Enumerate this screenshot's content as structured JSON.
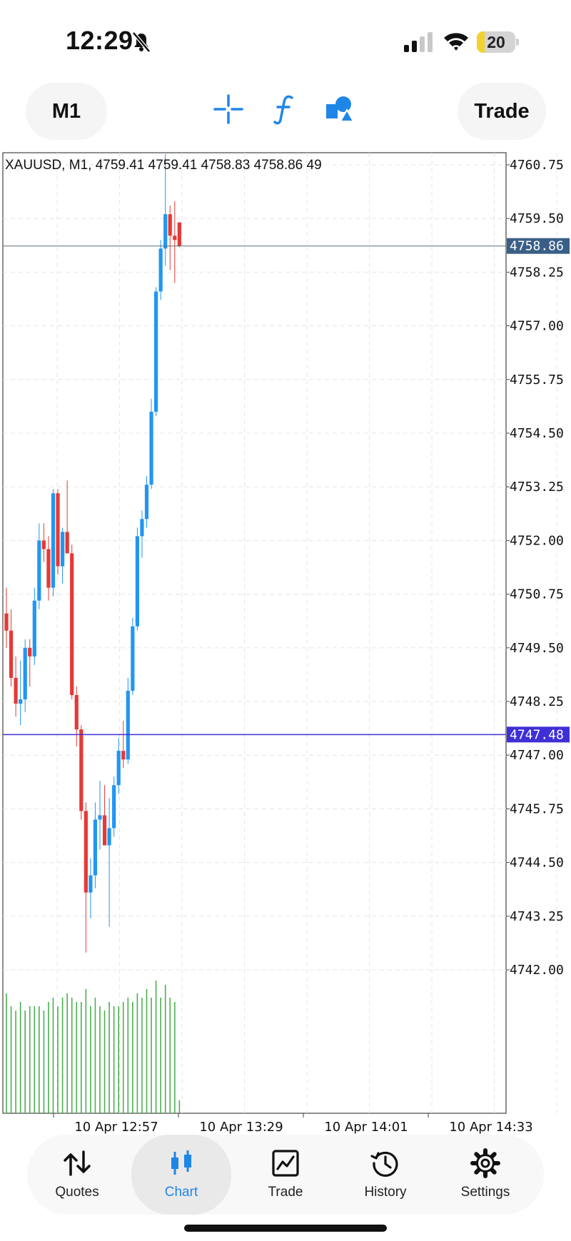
{
  "status_bar": {
    "time": "12:29",
    "battery_level": "20",
    "battery_fraction": 0.2
  },
  "toolbar": {
    "timeframe": "M1",
    "trade_label": "Trade",
    "icons": [
      "crosshair-icon",
      "function-icon",
      "objects-icon"
    ]
  },
  "chart": {
    "info": "XAUUSD, M1, 4759.41 4759.41 4758.83 4758.86 49",
    "current_price_label": "4758.86",
    "line_price_label": "4747.48",
    "price_ticks": [
      "4760.75",
      "4759.50",
      "4758.25",
      "4757.00",
      "4755.75",
      "4754.50",
      "4753.25",
      "4752.00",
      "4750.75",
      "4749.50",
      "4748.25",
      "4747.00",
      "4745.75",
      "4744.50",
      "4743.25",
      "4742.00"
    ],
    "time_ticks": [
      "10 Apr 12:57",
      "10 Apr 13:29",
      "10 Apr 14:01",
      "10 Apr 14:33"
    ],
    "colors": {
      "bull": "#2196f3",
      "bear": "#e53935",
      "volume": "#4caf50",
      "price_line": "#5c6b73",
      "horizontal_line": "#3f2fd6"
    }
  },
  "chart_data": {
    "type": "candlestick",
    "symbol": "XAUUSD",
    "timeframe": "M1",
    "ylim": [
      4741.0,
      4761.0
    ],
    "candles": [
      {
        "o": 4750.3,
        "h": 4750.9,
        "l": 4749.5,
        "c": 4749.9
      },
      {
        "o": 4749.9,
        "h": 4750.4,
        "l": 4748.6,
        "c": 4748.8
      },
      {
        "o": 4748.8,
        "h": 4749.3,
        "l": 4747.9,
        "c": 4748.2
      },
      {
        "o": 4748.2,
        "h": 4749.2,
        "l": 4747.7,
        "c": 4748.3
      },
      {
        "o": 4748.3,
        "h": 4749.7,
        "l": 4748.0,
        "c": 4749.5
      },
      {
        "o": 4749.5,
        "h": 4749.7,
        "l": 4748.6,
        "c": 4749.3
      },
      {
        "o": 4749.3,
        "h": 4750.9,
        "l": 4749.1,
        "c": 4750.6
      },
      {
        "o": 4750.6,
        "h": 4752.4,
        "l": 4750.4,
        "c": 4752.0
      },
      {
        "o": 4752.0,
        "h": 4752.4,
        "l": 4751.5,
        "c": 4751.8
      },
      {
        "o": 4751.8,
        "h": 4752.1,
        "l": 4750.6,
        "c": 4750.9
      },
      {
        "o": 4750.9,
        "h": 4753.2,
        "l": 4750.7,
        "c": 4753.1
      },
      {
        "o": 4753.1,
        "h": 4753.2,
        "l": 4751.2,
        "c": 4751.4
      },
      {
        "o": 4751.4,
        "h": 4752.3,
        "l": 4751.0,
        "c": 4752.2
      },
      {
        "o": 4752.2,
        "h": 4753.4,
        "l": 4751.7,
        "c": 4751.7
      },
      {
        "o": 4751.7,
        "h": 4751.9,
        "l": 4748.3,
        "c": 4748.4
      },
      {
        "o": 4748.4,
        "h": 4748.6,
        "l": 4747.2,
        "c": 4747.6
      },
      {
        "o": 4747.6,
        "h": 4747.7,
        "l": 4745.5,
        "c": 4745.7
      },
      {
        "o": 4745.7,
        "h": 4745.9,
        "l": 4742.4,
        "c": 4743.8
      },
      {
        "o": 4743.8,
        "h": 4744.6,
        "l": 4743.2,
        "c": 4744.2
      },
      {
        "o": 4744.2,
        "h": 4745.9,
        "l": 4743.9,
        "c": 4745.5
      },
      {
        "o": 4745.5,
        "h": 4746.4,
        "l": 4744.8,
        "c": 4745.6
      },
      {
        "o": 4745.6,
        "h": 4746.3,
        "l": 4744.9,
        "c": 4744.9
      },
      {
        "o": 4744.9,
        "h": 4746.0,
        "l": 4743.0,
        "c": 4745.3
      },
      {
        "o": 4745.3,
        "h": 4746.5,
        "l": 4745.1,
        "c": 4746.3
      },
      {
        "o": 4746.3,
        "h": 4747.4,
        "l": 4746.1,
        "c": 4747.1
      },
      {
        "o": 4747.1,
        "h": 4747.8,
        "l": 4746.7,
        "c": 4746.9
      },
      {
        "o": 4746.9,
        "h": 4748.8,
        "l": 4746.8,
        "c": 4748.5
      },
      {
        "o": 4748.5,
        "h": 4750.2,
        "l": 4748.4,
        "c": 4750.0
      },
      {
        "o": 4750.0,
        "h": 4752.3,
        "l": 4749.9,
        "c": 4752.1
      },
      {
        "o": 4752.1,
        "h": 4752.7,
        "l": 4751.6,
        "c": 4752.5
      },
      {
        "o": 4752.5,
        "h": 4753.5,
        "l": 4752.3,
        "c": 4753.3
      },
      {
        "o": 4753.3,
        "h": 4755.3,
        "l": 4753.2,
        "c": 4755.0
      },
      {
        "o": 4755.0,
        "h": 4757.9,
        "l": 4754.9,
        "c": 4757.8
      },
      {
        "o": 4757.8,
        "h": 4759.0,
        "l": 4757.6,
        "c": 4758.8
      },
      {
        "o": 4758.8,
        "h": 4761.0,
        "l": 4758.4,
        "c": 4759.6
      },
      {
        "o": 4759.6,
        "h": 4759.8,
        "l": 4758.3,
        "c": 4759.1
      },
      {
        "o": 4759.1,
        "h": 4759.9,
        "l": 4758.0,
        "c": 4759.0
      },
      {
        "o": 4759.41,
        "h": 4759.41,
        "l": 4758.83,
        "c": 4758.86
      }
    ],
    "volume": [
      28,
      25,
      24,
      26,
      24,
      25,
      25,
      25,
      24,
      26,
      27,
      25,
      27,
      28,
      27,
      26,
      26,
      29,
      25,
      27,
      25,
      24,
      26,
      25,
      25,
      26,
      27,
      26,
      28,
      27,
      29,
      27,
      31,
      27,
      30,
      27,
      26,
      3
    ]
  },
  "bottom_nav": {
    "items": [
      {
        "label": "Quotes",
        "icon": "quotes-arrows-icon"
      },
      {
        "label": "Chart",
        "icon": "candlestick-icon"
      },
      {
        "label": "Trade",
        "icon": "trade-chart-icon"
      },
      {
        "label": "History",
        "icon": "history-icon"
      },
      {
        "label": "Settings",
        "icon": "gear-icon"
      }
    ],
    "active": "Chart"
  }
}
